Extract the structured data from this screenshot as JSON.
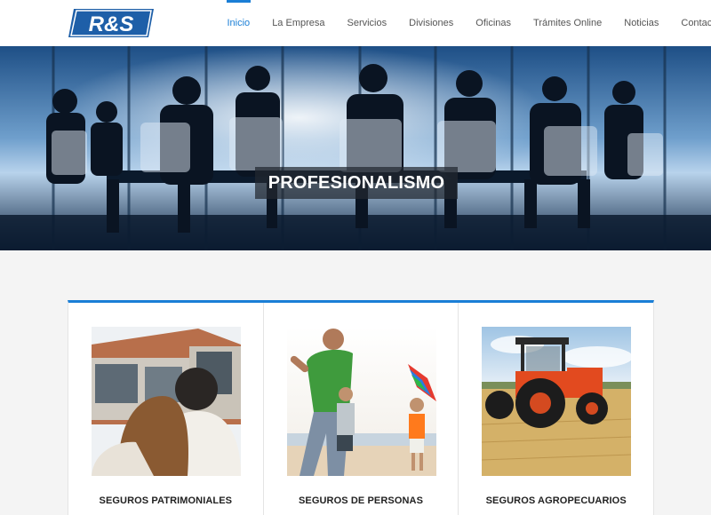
{
  "brand": {
    "logo_text": "R&S",
    "accent_color": "#1a7ed6"
  },
  "nav": {
    "items": [
      {
        "label": "Inicio",
        "active": true
      },
      {
        "label": "La Empresa"
      },
      {
        "label": "Servicios"
      },
      {
        "label": "Divisiones"
      },
      {
        "label": "Oficinas"
      },
      {
        "label": "Trámites Online"
      },
      {
        "label": "Noticias"
      },
      {
        "label": "Contacto"
      }
    ]
  },
  "hero": {
    "title": "PROFESIONALISMO",
    "image": "business-meeting-silhouettes"
  },
  "cards": [
    {
      "title": "SEGUROS PATRIMONIALES",
      "image": "couple-house-photo"
    },
    {
      "title": "SEGUROS DE PERSONAS",
      "image": "family-kite-beach-photo"
    },
    {
      "title": "SEGUROS AGROPECUARIOS",
      "image": "tractor-field-photo"
    }
  ]
}
